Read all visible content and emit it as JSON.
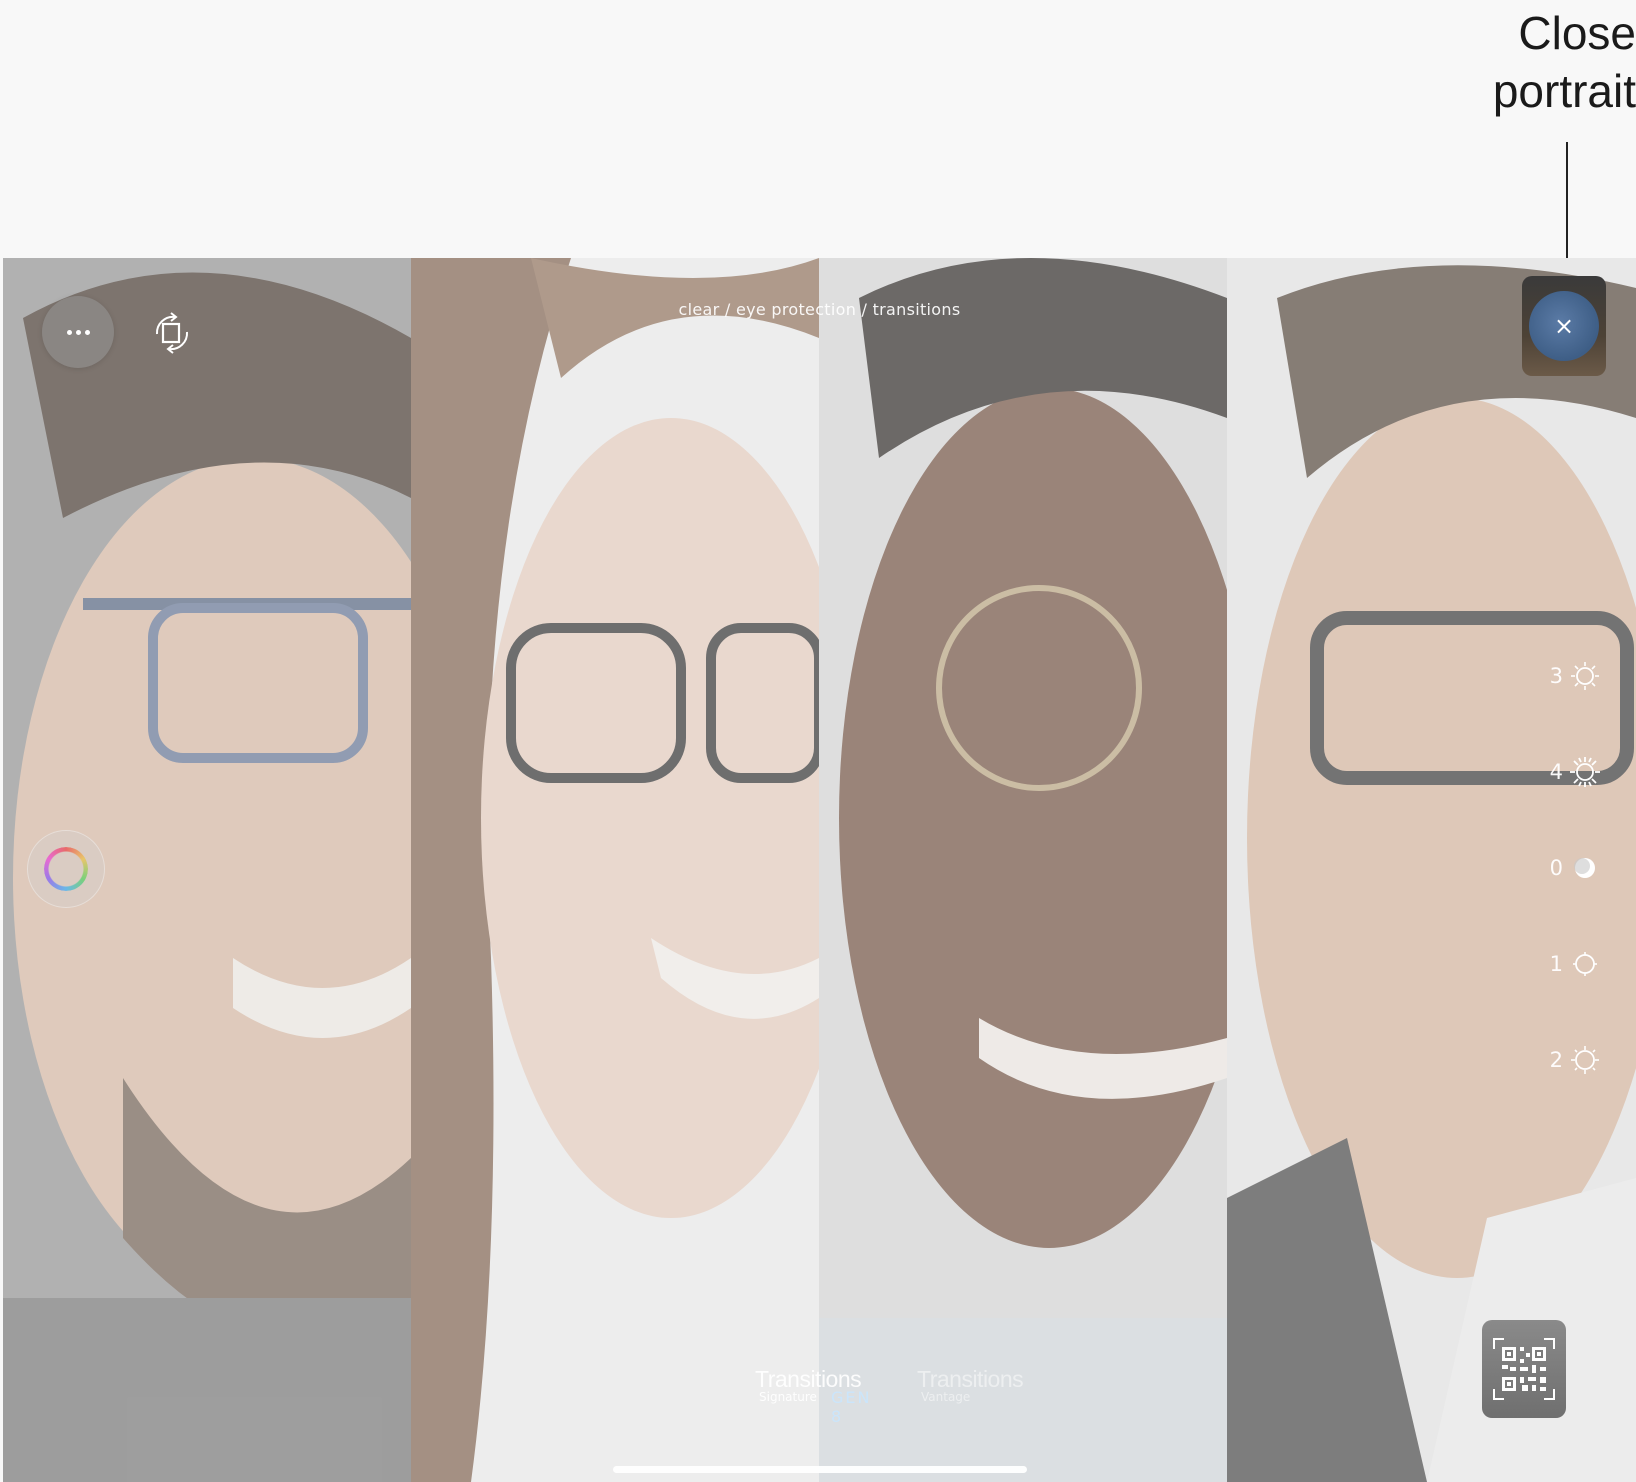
{
  "callout": {
    "line1": "Close",
    "line2": "portrait"
  },
  "header": {
    "mode_label": "clear / eye protection / transitions"
  },
  "controls": {
    "menu_icon": "ellipsis-icon",
    "rotate_icon": "rotate-device-icon",
    "color_icon": "color-wheel-icon",
    "close_icon": "close-icon",
    "close_glyph": "×",
    "qr_icon": "qr-code-icon"
  },
  "light_levels": [
    {
      "value": "3",
      "icon": "sun-bright-icon"
    },
    {
      "value": "4",
      "icon": "sun-full-icon"
    },
    {
      "value": "0",
      "icon": "moon-full-icon"
    },
    {
      "value": "1",
      "icon": "sun-dim-icon"
    },
    {
      "value": "2",
      "icon": "sun-medium-icon"
    }
  ],
  "brands": {
    "primary_name": "Transitions",
    "primary_sub": "Signature",
    "primary_gen": "GEN 8",
    "secondary_name": "Transitions",
    "secondary_sub": "Vantage"
  },
  "colors": {
    "close_button": "#3e5e86",
    "overlay": "#ebebeb"
  }
}
